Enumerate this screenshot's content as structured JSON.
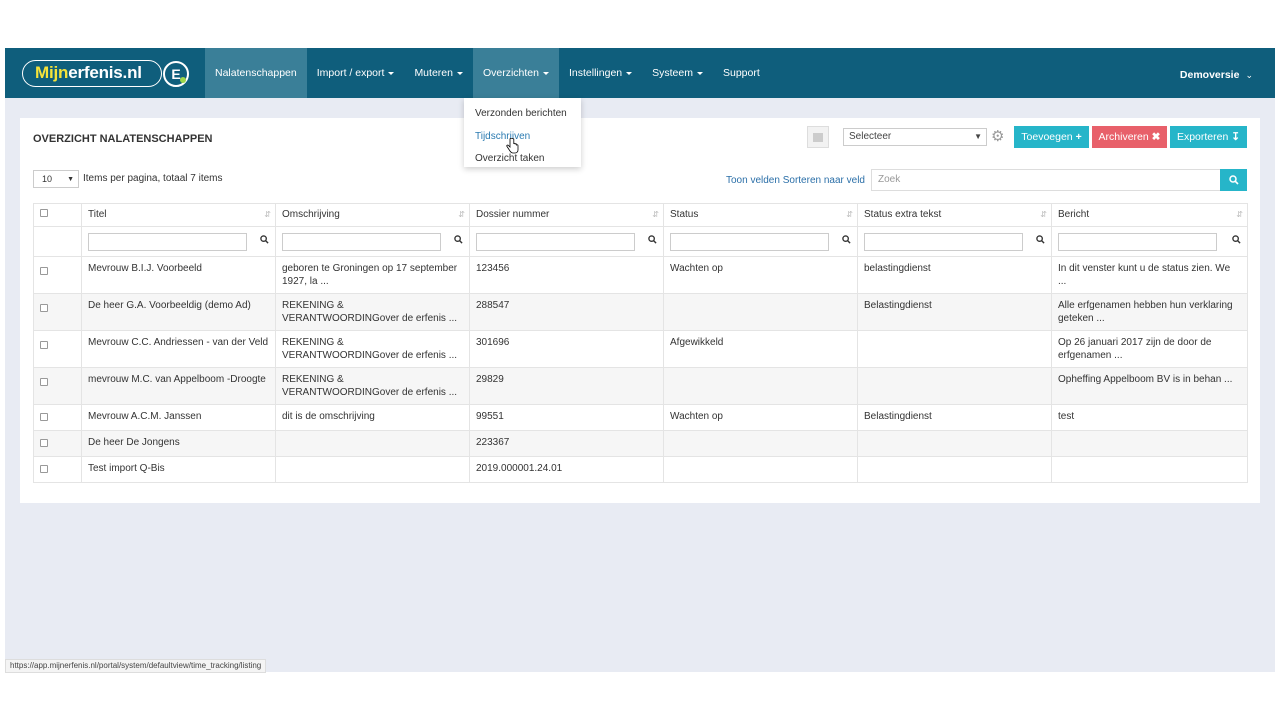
{
  "brand": {
    "name_part1": "Mijn",
    "name_part2": "erfenis.nl",
    "badge": "E"
  },
  "nav": {
    "items": [
      {
        "label": "Nalatenschappen",
        "active": false,
        "dropdown": false
      },
      {
        "label": "Import / export",
        "active": false,
        "dropdown": true
      },
      {
        "label": "Muteren",
        "active": false,
        "dropdown": true
      },
      {
        "label": "Overzichten",
        "active": true,
        "dropdown": true
      },
      {
        "label": "Instellingen",
        "active": false,
        "dropdown": true
      },
      {
        "label": "Systeem",
        "active": false,
        "dropdown": true
      },
      {
        "label": "Support",
        "active": false,
        "dropdown": false
      }
    ],
    "user": "Demoversie"
  },
  "dropdown": {
    "items": [
      "Verzonden berichten",
      "Tijdschrijven",
      "Overzicht taken"
    ],
    "hovered": "Tijdschrijven"
  },
  "panel": {
    "title": "OVERZICHT NALATENSCHAPPEN",
    "select_value": "Selecteer",
    "buttons": {
      "add": "Toevoegen",
      "archive": "Archiveren",
      "export": "Exporteren"
    },
    "per_page_value": "10",
    "per_page_text": "Items per pagina, totaal 7 items",
    "show_fields": "Toon velden",
    "sort_by_field": "Sorteren naar veld",
    "search_placeholder": "Zoek"
  },
  "table": {
    "columns": [
      "Titel",
      "Omschrijving",
      "Dossier nummer",
      "Status",
      "Status extra tekst",
      "Bericht"
    ],
    "rows": [
      [
        "Mevrouw B.I.J. Voorbeeld",
        "geboren te Groningen op 17 september 1927, la ...",
        "123456",
        "Wachten op",
        "belastingdienst",
        "In dit venster kunt u de status zien. We ..."
      ],
      [
        "De heer G.A. Voorbeeldig (demo Ad)",
        "REKENING & VERANTWOORDINGover de erfenis ...",
        "288547",
        "",
        "Belastingdienst",
        "Alle erfgenamen hebben hun verklaring geteken ..."
      ],
      [
        "Mevrouw C.C. Andriessen - van der Veld",
        "REKENING & VERANTWOORDINGover de erfenis ...",
        "301696",
        "Afgewikkeld",
        "",
        "Op 26 januari 2017 zijn de door de erfgenamen ..."
      ],
      [
        "mevrouw M.C. van Appelboom -Droogte",
        "REKENING & VERANTWOORDINGover de erfenis ...",
        "29829",
        "",
        "",
        "Opheffing Appelboom BV  is in behan ..."
      ],
      [
        "Mevrouw A.C.M. Janssen",
        "dit is de omschrijving",
        "99551",
        "Wachten op",
        "Belastingdienst",
        "test"
      ],
      [
        "De heer De Jongens",
        "",
        "223367",
        "",
        "",
        ""
      ],
      [
        "Test import Q-Bis",
        "",
        "2019.000001.24.01",
        "",
        "",
        ""
      ]
    ]
  },
  "statusbar": {
    "url": "https://app.mijnerfenis.nl/portal/system/defaultview/time_tracking/listing"
  },
  "colors": {
    "navbar": "#0f5e7c",
    "accent": "#26b5c9",
    "danger": "#e8606a",
    "background": "#e8ebf3"
  }
}
